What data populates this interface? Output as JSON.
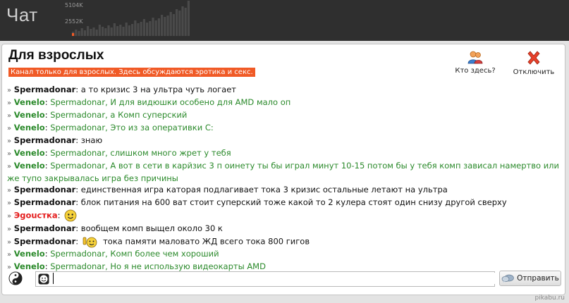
{
  "app": {
    "title": "Чат"
  },
  "traffic": {
    "label_high": "5104K",
    "label_low": "2552K"
  },
  "channel": {
    "title": "Для взрослых",
    "description": "Канал только для взрослых. Здесь обсуждаются эротика и секс."
  },
  "actions": {
    "who": "Кто здесь?",
    "disconnect": "Отключить"
  },
  "messages": [
    {
      "arrow": "»",
      "nick": "Spermadonar",
      "sep": ": ",
      "text": "а то кризис 3 на ультра чуть логает",
      "color": "black"
    },
    {
      "arrow": "»",
      "nick": "Venelo",
      "sep": ": ",
      "text": "Spermadonar, И для видюшки особено для AMD мало оп",
      "color": "green"
    },
    {
      "arrow": "»",
      "nick": "Venelo",
      "sep": ": ",
      "text": "Spermadonar, а Комп суперский",
      "color": "green"
    },
    {
      "arrow": "»",
      "nick": "Venelo",
      "sep": ": ",
      "text": "Spermadonar, Это из за оперативки С:",
      "color": "green"
    },
    {
      "arrow": "»",
      "nick": "Spermadonar",
      "sep": ": ",
      "text": "знаю",
      "color": "black"
    },
    {
      "arrow": "»",
      "nick": "Venelo",
      "sep": ": ",
      "text": "Spermadonar, слишком много жрет у тебя",
      "color": "green"
    },
    {
      "arrow": "»",
      "nick": "Venelo",
      "sep": ": ",
      "text": "Spermadonar, А вот в сети в карйзис 3 п оинету ты бы играл минут 10-15 потом бы у тебя комп зависал намертво или же тупо закрывалась игра без причины",
      "color": "green"
    },
    {
      "arrow": "»",
      "nick": "Spermadonar",
      "sep": ": ",
      "text": "единственная игра каторая подлагивает тока 3 кризис остальные летают на ультра",
      "color": "black"
    },
    {
      "arrow": "»",
      "nick": "Spermadonar",
      "sep": ": ",
      "text": "блок питания на 600 ват стоит суперский тоже какой то 2 кулера стоят один снизу другой сверху",
      "color": "black"
    },
    {
      "arrow": "»",
      "nick": "Эgouстка",
      "sep": ": ",
      "text": "",
      "color": "red",
      "smiley": "smile-icon"
    },
    {
      "arrow": "»",
      "nick": "Spermadonar",
      "sep": ": ",
      "text": "вообщем комп выщел около 30 к",
      "color": "black"
    },
    {
      "arrow": "»",
      "nick": "Spermadonar",
      "sep": ": ",
      "text": "тока памяти маловато ЖД всего тока 800 гигов",
      "color": "black",
      "smiley": "thumbs-up-smiley-icon"
    },
    {
      "arrow": "»",
      "nick": "Venelo",
      "sep": ": ",
      "text": "Spermadonar, Комп более чем хороший",
      "color": "green"
    },
    {
      "arrow": "»",
      "nick": "Venelo",
      "sep": ": ",
      "text": "Spermadonar, Но я не использую видеокарты AMD",
      "color": "green"
    }
  ],
  "input": {
    "value": "",
    "send_label": "Отправить"
  },
  "watermark": "pikabu.ru",
  "colors": {
    "topbar": "#2f2f2f",
    "accent": "#f05a26",
    "green_text": "#2b8a2b",
    "red_text": "#e41d1d"
  }
}
